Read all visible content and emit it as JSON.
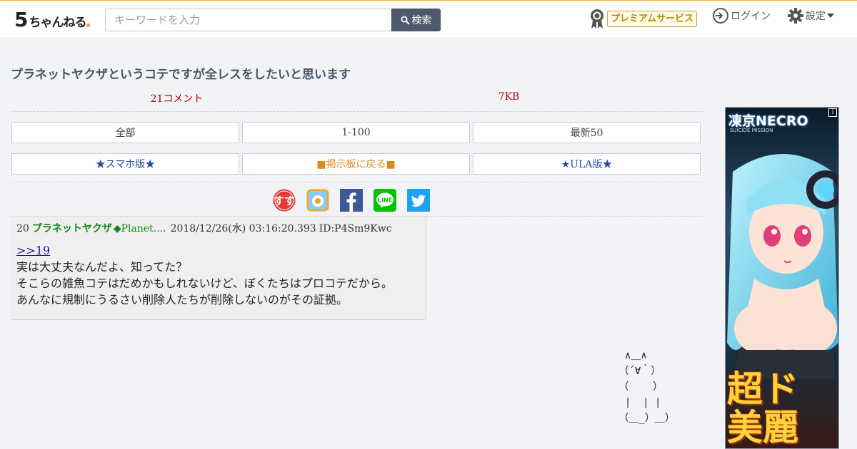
{
  "header": {
    "logo_five": "5",
    "logo_text": "ちゃんねる",
    "search_placeholder": "キーワードを入力",
    "search_button": "検索",
    "premium_label": "プレミアムサービス",
    "login_label": "ログイン",
    "settings_label": "設定",
    "accent_color": "#f0b040"
  },
  "thread": {
    "title": "プラネットヤクザというコテですが全レスをしたいと思います",
    "comment_count": "21コメント",
    "size": "7KB"
  },
  "nav": {
    "all": "全部",
    "range": "1-100",
    "latest": "最新50",
    "smartphone": "★スマホ版★",
    "back_to_board": "■掲示板に戻る■",
    "ula": "★ULA版★"
  },
  "share": [
    "ss-icon",
    "bookmark-app-icon",
    "facebook-icon",
    "line-icon",
    "twitter-icon"
  ],
  "post": {
    "number": "20",
    "name": "プラネットヤクザ",
    "trip": "◆Planet....",
    "date": "2018/12/26(水) 03:16:20.393",
    "id": "ID:P4Sm9Kwc",
    "anchor": ">>19",
    "lines": [
      "実は大丈夫なんだよ、知ってた？",
      "そこらの雑魚コテはだめかもしれないけど、ぼくたちはプロコテだから。",
      "あんなに規制にうるさい削除人たちが削除しないのがその証拠。"
    ]
  },
  "ad": {
    "brand": "凍京NECRO",
    "sub": "SUICIDE MISSION",
    "info": "i",
    "headline": "超ド\n美麗"
  }
}
